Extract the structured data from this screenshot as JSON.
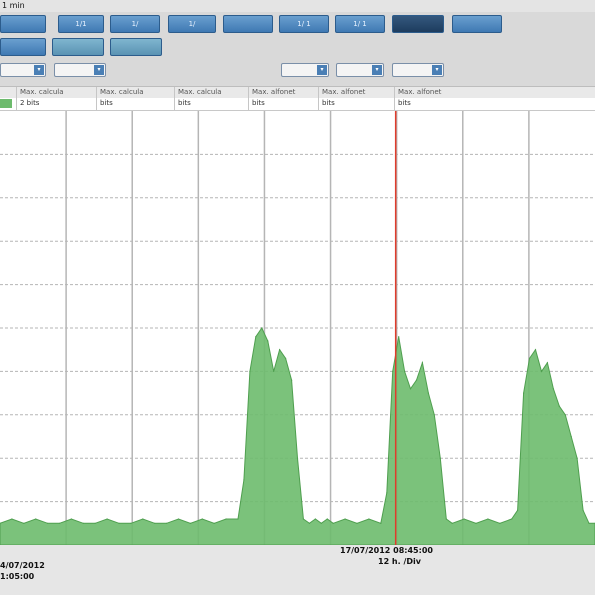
{
  "window": {
    "title": "1 min"
  },
  "toolbar": {
    "row1": [
      "",
      "1/1",
      "1/",
      "1/",
      "",
      "1/ 1",
      "1/ 1",
      "",
      ""
    ],
    "row2": [
      "",
      "",
      ""
    ],
    "row3_left": [
      "",
      ""
    ],
    "row3_right": [
      "",
      "",
      ""
    ]
  },
  "legend": {
    "headers": [
      "Max. calcula",
      "Max. calcula",
      "Max. calcula",
      "Max. alfonet",
      "Max. alfonet",
      "Max. alfonet"
    ],
    "values": [
      "2 bits",
      "bits",
      "bits",
      "bits",
      "bits",
      "bits"
    ]
  },
  "footer": {
    "start_date": "4/07/2012",
    "start_time": "1:05:00",
    "cursor_datetime": "17/07/2012 08:45:00",
    "scale": "12 h. /Div"
  },
  "colors": {
    "signal": "#6dbb6d",
    "cursor": "#e03c2c",
    "grid": "#b5b5b5",
    "toolbar_button": "#4a86c0"
  },
  "chart_data": {
    "type": "area",
    "title": "",
    "xlabel": "",
    "ylabel": "",
    "ylim": [
      0,
      100
    ],
    "x": [
      0,
      2,
      4,
      6,
      8,
      10,
      12,
      14,
      16,
      18,
      20,
      22,
      24,
      26,
      28,
      30,
      32,
      34,
      36,
      38,
      40,
      41,
      42,
      43,
      44,
      45,
      46,
      47,
      48,
      49,
      50,
      51,
      52,
      53,
      54,
      55,
      56,
      58,
      60,
      62,
      64,
      65,
      66,
      67,
      68,
      69,
      70,
      71,
      72,
      73,
      74,
      75,
      76,
      78,
      80,
      82,
      84,
      86,
      87,
      88,
      89,
      90,
      91,
      92,
      93,
      94,
      95,
      96,
      97,
      98,
      99,
      100
    ],
    "series": [
      {
        "values": [
          5,
          6,
          5,
          6,
          5,
          5,
          6,
          5,
          5,
          6,
          5,
          5,
          6,
          5,
          5,
          6,
          5,
          6,
          5,
          6,
          6,
          15,
          40,
          48,
          50,
          47,
          40,
          45,
          43,
          38,
          20,
          6,
          5,
          6,
          5,
          6,
          5,
          6,
          5,
          6,
          5,
          12,
          40,
          48,
          40,
          36,
          38,
          42,
          35,
          30,
          20,
          6,
          5,
          6,
          5,
          6,
          5,
          6,
          8,
          35,
          43,
          45,
          40,
          42,
          36,
          32,
          30,
          25,
          20,
          8,
          5,
          5
        ]
      }
    ],
    "grid": true,
    "cursor_x": 66.5
  }
}
